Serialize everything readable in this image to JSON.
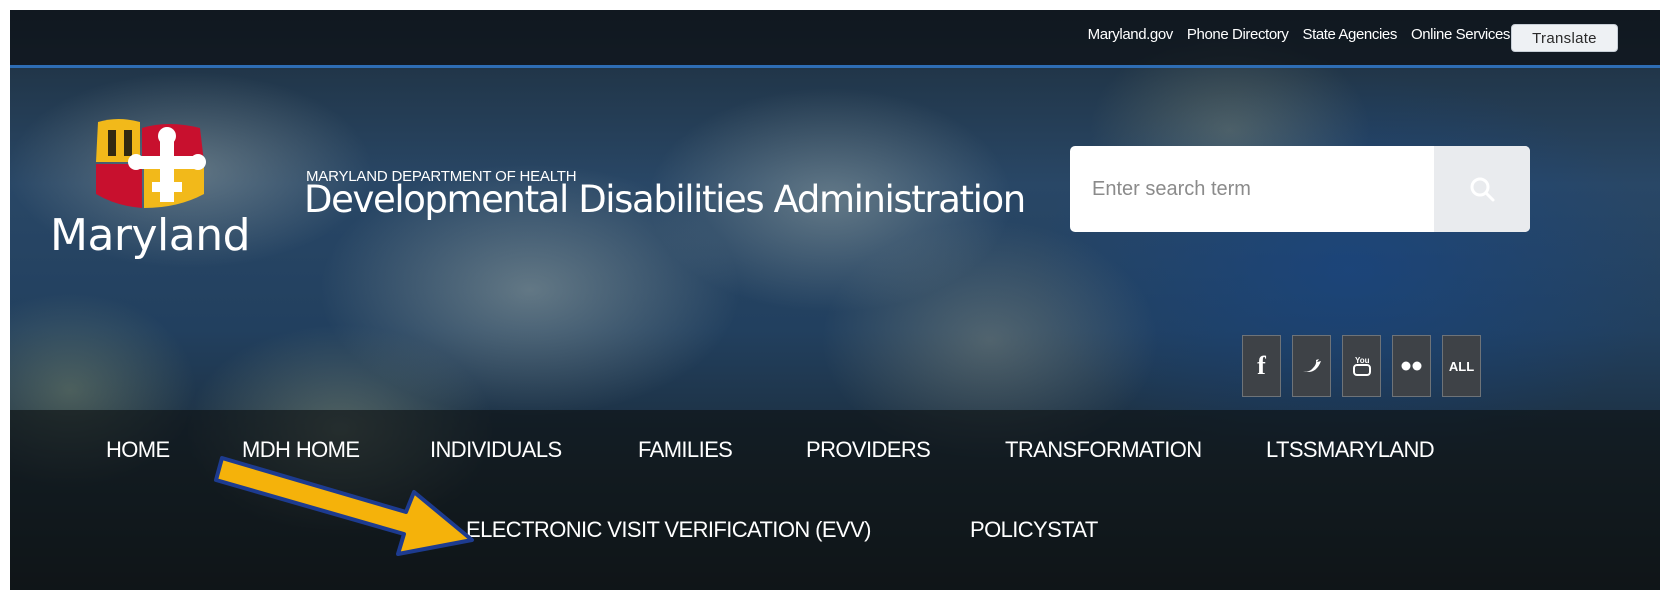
{
  "utility_bar": {
    "links": [
      "Maryland.gov",
      "Phone Directory",
      "State Agencies",
      "Online Services"
    ],
    "translate_label": "Translate"
  },
  "logo": {
    "wordmark": "Maryland"
  },
  "header": {
    "department": "MARYLAND DEPARTMENT OF HEALTH",
    "title": "Developmental Disabilities Administration"
  },
  "search": {
    "placeholder": "Enter search term",
    "icon": "search-icon"
  },
  "social": [
    {
      "label": "f",
      "icon": "facebook-icon"
    },
    {
      "label": "",
      "icon": "twitter-icon"
    },
    {
      "label": "",
      "icon": "youtube-icon"
    },
    {
      "label": "",
      "icon": "flickr-icon"
    },
    {
      "label": "ALL",
      "icon": "all-social-icon"
    }
  ],
  "nav": {
    "row1": [
      "HOME",
      "MDH HOME",
      "INDIVIDUALS",
      "FAMILIES",
      "PROVIDERS",
      "TRANSFORMATION",
      "LTSSMARYLAND"
    ],
    "row2": [
      "ELECTRONIC VISIT VERIFICATION (EVV)",
      "POLICYSTAT"
    ]
  },
  "colors": {
    "arrow": "#f5b20a",
    "arrow_outline": "#1d3b8f",
    "flag_red": "#c8102e",
    "flag_gold": "#f2b91a",
    "util_border": "#2e6db4"
  }
}
